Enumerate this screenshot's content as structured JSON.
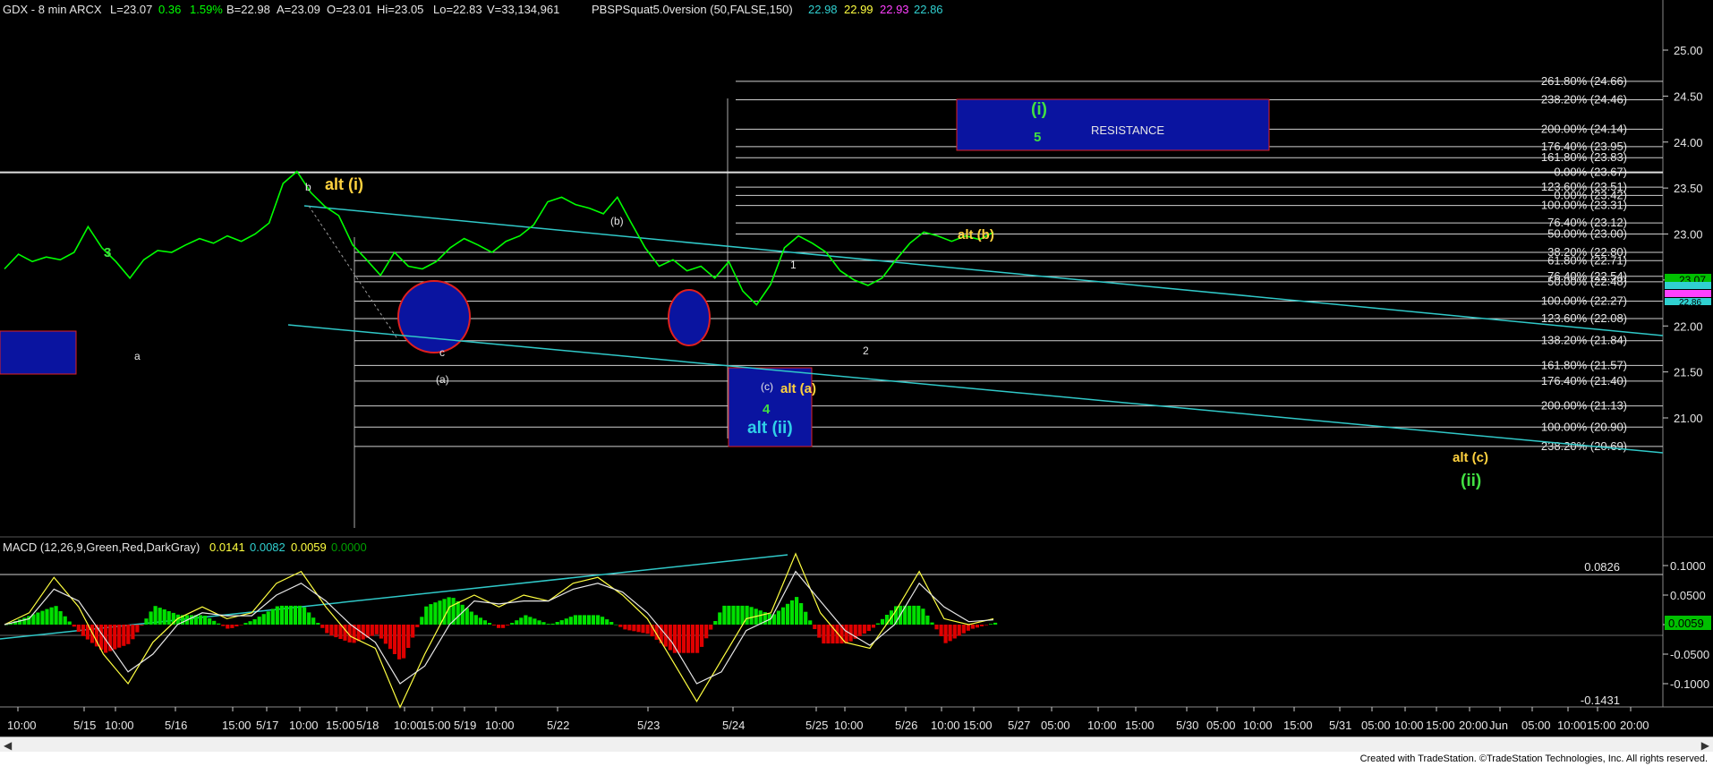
{
  "header": {
    "symbol": "GDX - 8 min  ARCX",
    "last": "L=23.07",
    "change": "0.36",
    "change_pct": "1.59%",
    "bid": "B=22.98",
    "ask": "A=23.09",
    "open": "O=23.01",
    "high": "Hi=23.05",
    "low": "Lo=22.83",
    "volume": "V=33,134,961",
    "study": "PBSPSquat5.0version (50,FALSE,150)",
    "study_values": [
      "22.98",
      "22.99",
      "22.93",
      "22.86"
    ],
    "study_colors": [
      "#30d0d0",
      "#ffff40",
      "#ff40ff",
      "#30d0d0"
    ]
  },
  "macd_header": {
    "label": "MACD (12,26,9,Green,Red,DarkGray)",
    "values": [
      "0.0141",
      "0.0082",
      "0.0059",
      "0.0000"
    ],
    "colors": [
      "#ffff40",
      "#30d0d0",
      "#ffff40",
      "#00a000"
    ]
  },
  "colors": {
    "background": "#000000",
    "price_up": "#00ff00",
    "fib_line": "#d0d0d0",
    "trendline": "#30c8c8",
    "wave_yellow": "#ffd23f",
    "wave_green": "#42e042",
    "box_blue": "#0a14a0",
    "circle_red": "#e02020",
    "macd_up": "#00e000",
    "macd_down": "#e00000"
  },
  "chart_data": [
    {
      "type": "line",
      "title": "GDX - 8 min",
      "ylim": [
        20.75,
        25.35
      ],
      "y_ticks": [
        "25.00",
        "24.50",
        "24.00",
        "23.50",
        "23.00",
        "22.50",
        "22.00",
        "21.50",
        "21.00"
      ],
      "x_tick_labels": [
        "10:00",
        "5/15",
        "10:00",
        "5/16",
        "15:00",
        "5/17",
        "10:00",
        "15:00",
        "5/18",
        "10:00",
        "15:00",
        "5/19",
        "10:00",
        "5/22",
        "5/23",
        "5/24",
        "5/25",
        "10:00",
        "5/26",
        "10:00",
        "15:00",
        "5/27",
        "05:00",
        "10:00",
        "15:00",
        "5/30",
        "05:00",
        "10:00",
        "15:00",
        "5/31",
        "05:00",
        "10:00",
        "15:00",
        "20:00",
        "Jun",
        "05:00",
        "10:00",
        "15:00",
        "20:00"
      ],
      "series": [
        {
          "values": [
            22.62,
            22.78,
            22.7,
            22.75,
            22.72,
            22.8,
            23.08,
            22.85,
            22.7,
            22.52,
            22.72,
            22.82,
            22.8,
            22.88,
            22.95,
            22.9,
            22.98,
            22.92,
            23.0,
            23.12,
            23.55,
            23.68,
            23.45,
            23.3,
            23.2,
            22.88,
            22.72,
            22.55,
            22.8,
            22.65,
            22.62,
            22.7,
            22.85,
            22.95,
            22.88,
            22.8,
            22.92,
            22.98,
            23.1,
            23.35,
            23.4,
            23.32,
            23.28,
            23.22,
            23.4,
            23.12,
            22.85,
            22.65,
            22.72,
            22.6,
            22.65,
            22.52,
            22.7,
            22.38,
            22.23,
            22.45,
            22.85,
            22.98,
            22.9,
            22.8,
            22.6,
            22.5,
            22.44,
            22.52,
            22.72,
            22.9,
            23.02,
            22.98,
            22.92,
            22.98,
            22.94,
            23.02
          ]
        }
      ],
      "current_price_labels": [
        "23.07",
        "22.98",
        "22.93",
        "22.86"
      ],
      "fib_levels_upper": [
        "261.80% (24.66)",
        "238.20% (24.46)",
        "200.00% (24.14)",
        "176.40% (23.95)",
        "161.80% (23.83)",
        "0.00% (23.67)",
        "123.60% (23.51)",
        "0.00% (23.42)",
        "100.00% (23.31)",
        "76.40% (23.12)",
        "50.00% (23.00)",
        "38.20% (22.80)",
        "61.80% (22.71)",
        "76.40% (22.54)",
        "50.00% (22.48)",
        "100.00% (22.27)",
        "123.60% (22.08)",
        "138.20% (21.84)",
        "161.80% (21.57)",
        "176.40% (21.40)",
        "200.00% (21.13)",
        "100.00% (20.90)",
        "238.20% (20.69)"
      ],
      "annotations": [
        "alt (i)",
        "b",
        "3",
        "a",
        "c",
        "(a)",
        "(b)",
        "(c)",
        "1",
        "2",
        "alt (a)",
        "4",
        "alt (ii)",
        "(i)",
        "5",
        "RESISTANCE",
        "alt (b)",
        "alt (c)",
        "(ii)"
      ]
    },
    {
      "type": "bar",
      "title": "MACD (12,26,9,Green,Red,DarkGray)",
      "ylim": [
        -0.16,
        0.13
      ],
      "y_ticks": [
        "0.1000",
        "0.0500",
        "0.0000",
        "-0.0500",
        "-0.1000"
      ],
      "levels": [
        "0.0826",
        "-0.1431"
      ],
      "current_value": "0.0059",
      "macd": [
        0.0,
        0.02,
        0.08,
        0.03,
        -0.05,
        -0.1,
        -0.03,
        0.01,
        0.03,
        0.01,
        0.02,
        0.07,
        0.09,
        0.03,
        -0.02,
        -0.04,
        -0.14,
        -0.05,
        0.03,
        0.05,
        0.03,
        0.05,
        0.04,
        0.07,
        0.08,
        0.05,
        0.01,
        -0.06,
        -0.13,
        -0.06,
        0.01,
        0.02,
        0.12,
        0.02,
        -0.03,
        -0.04,
        0.02,
        0.09,
        0.01,
        0.0,
        0.01
      ],
      "signal": [
        0.0,
        0.01,
        0.06,
        0.04,
        -0.02,
        -0.08,
        -0.05,
        0.0,
        0.02,
        0.015,
        0.015,
        0.05,
        0.07,
        0.04,
        0.0,
        -0.03,
        -0.1,
        -0.07,
        0.0,
        0.04,
        0.035,
        0.04,
        0.04,
        0.06,
        0.07,
        0.055,
        0.02,
        -0.03,
        -0.1,
        -0.08,
        -0.01,
        0.01,
        0.09,
        0.04,
        -0.01,
        -0.035,
        0.0,
        0.07,
        0.03,
        0.005,
        0.008
      ]
    }
  ],
  "footer": "Created with TradeStation. ©TradeStation Technologies, Inc. All rights reserved."
}
